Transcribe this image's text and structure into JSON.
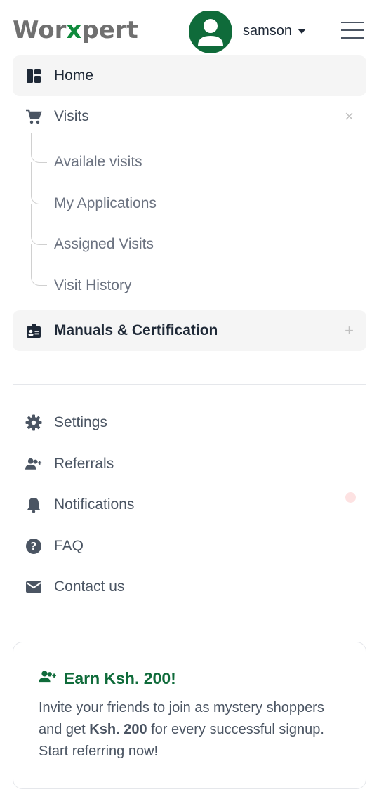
{
  "header": {
    "logo_part1": "Wor",
    "logo_part2": "x",
    "logo_part3": "pert",
    "username": "samson",
    "brand_color": "#0f8a3c"
  },
  "nav": {
    "home": "Home",
    "visits": "Visits",
    "visits_toggle": "×",
    "visits_sub": [
      "Availale visits",
      "My Applications",
      "Assigned Visits",
      "Visit History"
    ],
    "manuals": "Manuals & Certification",
    "manuals_toggle": "+"
  },
  "secondary_nav": {
    "settings": "Settings",
    "referrals": "Referrals",
    "notifications": "Notifications",
    "faq": "FAQ",
    "contact": "Contact us"
  },
  "promo": {
    "title": "Earn Ksh. 200!",
    "body_part1": "Invite your friends to join as mystery shoppers and get ",
    "body_bold": "Ksh. 200",
    "body_part2": " for every successful signup. Start referring now!"
  }
}
